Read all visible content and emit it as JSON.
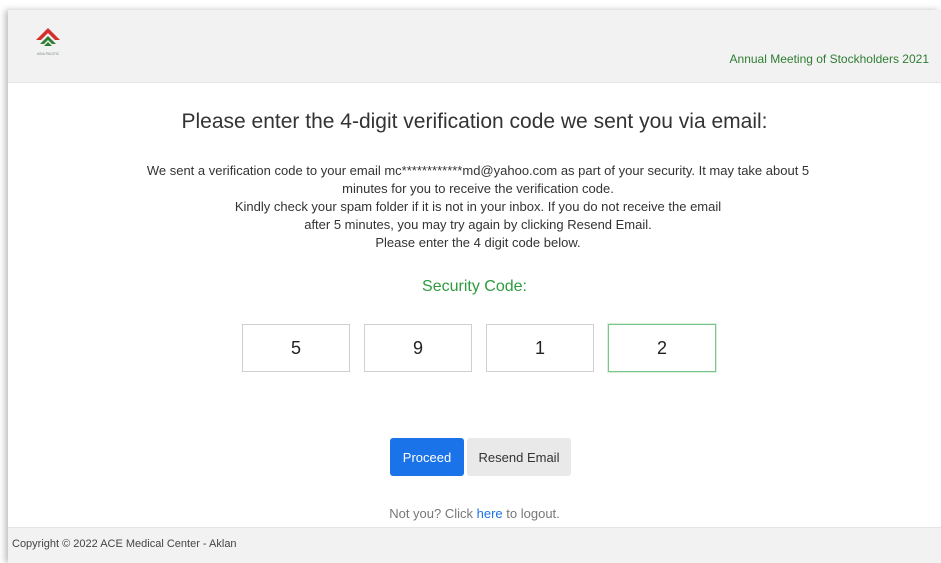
{
  "header": {
    "logo_text": "ASIA PACIFIC",
    "event_title": "Annual Meeting of Stockholders 2021"
  },
  "main": {
    "heading": "Please enter the 4-digit verification code we sent you via email:",
    "message_lines": [
      "We sent a verification code to your email mc************md@yahoo.com as part of your security. It may take about 5",
      "minutes for you to receive the verification code.",
      "Kindly check your spam folder if it is not in your inbox. If you do not receive the email",
      "after 5 minutes, you may try again by clicking Resend Email.",
      "Please enter the 4 digit code below."
    ],
    "security_code_label": "Security Code:",
    "code_digits": [
      "5",
      "9",
      "1",
      "2"
    ],
    "proceed_label": "Proceed",
    "resend_label": "Resend Email",
    "logout_prefix": "Not you? Click",
    "logout_link": "here",
    "logout_suffix": "to logout."
  },
  "footer": {
    "copyright": "Copyright © 2022 ACE Medical Center - Aklan"
  },
  "colors": {
    "accent_green": "#2e9b3e",
    "primary_blue": "#1a73e8",
    "logo_red": "#d32f2f",
    "logo_green": "#2e7d32"
  }
}
